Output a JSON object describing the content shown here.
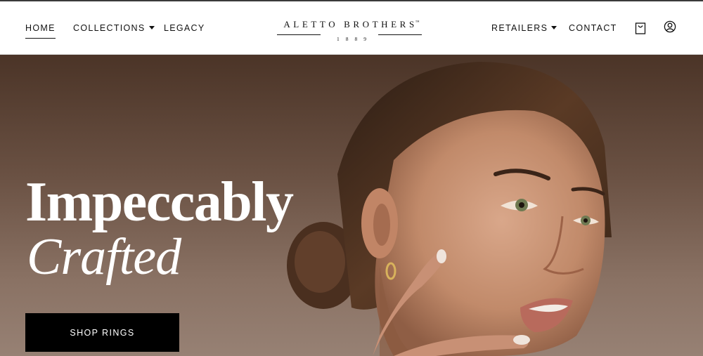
{
  "nav": {
    "left": [
      {
        "label": "HOME",
        "active": true
      },
      {
        "label": "COLLECTIONS",
        "dropdown": true
      },
      {
        "label": "LEGACY"
      }
    ],
    "right": [
      {
        "label": "RETAILERS",
        "dropdown": true
      },
      {
        "label": "CONTACT"
      }
    ],
    "icons": [
      "shopping-bag-icon",
      "account-icon"
    ]
  },
  "logo": {
    "name": "ALETTO BROTHERS",
    "trademark": "™",
    "year": "1889"
  },
  "hero": {
    "headline_line1": "Impeccably",
    "headline_line2": "Crafted",
    "cta_label": "SHOP RINGS"
  },
  "colors": {
    "text": "#111111",
    "hero_bg_top": "#4b3427",
    "hero_bg_bottom": "#978174",
    "cta_bg": "#000000",
    "cta_text": "#ffffff"
  }
}
